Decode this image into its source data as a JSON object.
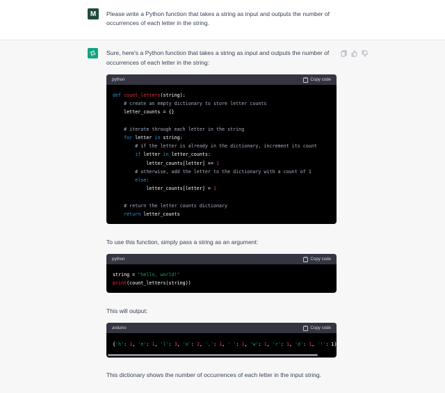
{
  "user": {
    "avatar_letter": "M",
    "message_line1": "Please write a Python function that takes a string as input and outputs the number of",
    "message_line2": "occurrences of each letter in the string."
  },
  "assistant": {
    "intro_line1": "Sure, here's a Python function that takes a string as input and outputs the number of",
    "intro_line2": "occurrences of each letter in the string:",
    "use_text": "To use this function, simply pass a string as an argument:",
    "output_text": "This will output:",
    "closing_text": "This dictionary shows the number of occurrences of each letter in the input string."
  },
  "code_blocks": [
    {
      "language": "python",
      "copy_label": "Copy code"
    },
    {
      "language": "python",
      "copy_label": "Copy code"
    },
    {
      "language": "arduino",
      "copy_label": "Copy code"
    }
  ],
  "code1": {
    "def": "def",
    "fname": "count_letters",
    "sig": "(string):",
    "c1": "# create an empty dictionary to store letter counts",
    "l1": "letter_counts = {}",
    "c2": "# iterate through each letter in the string",
    "for": "for",
    "for_mid": " letter ",
    "in": "in",
    "for_end": " string:",
    "c3": "# if the letter is already in the dictionary, increment its count",
    "if": "if",
    "if_mid": " letter ",
    "in2": "in",
    "if_end": " letter_counts:",
    "inc": "letter_counts[letter] += ",
    "one1": "1",
    "c4": "# otherwise, add the letter to the dictionary with a count of 1",
    "else": "else:",
    "assign": "letter_counts[letter] = ",
    "one2": "1",
    "c5": "# return the letter counts dictionary",
    "return": "return",
    "ret_val": " letter_counts"
  },
  "code2": {
    "var": "string = ",
    "str": "\"hello, world!\"",
    "print": "print",
    "args": "(count_letters(string))"
  },
  "code3": {
    "t1": "{",
    "k1": "'h'",
    "t2": ": ",
    "v1": "1",
    "t3": ", ",
    "k2": "'e'",
    "t4": ": ",
    "v2": "1",
    "t5": ", ",
    "k3": "'l'",
    "t6": ": ",
    "v3": "3",
    "t7": ", ",
    "k4": "'o'",
    "t8": ": ",
    "v4": "2",
    "t9": ", ",
    "k5": "','",
    "t10": ": ",
    "v5": "1",
    "t11": ", ",
    "k6": "' '",
    "t12": ": ",
    "v6": "1",
    "t13": ", ",
    "k7": "'w'",
    "t14": ": ",
    "v7": "1",
    "t15": ", ",
    "k8": "'r'",
    "t16": ": ",
    "v8": "1",
    "t17": ", ",
    "k9": "'d'",
    "t18": ": ",
    "v9": "1",
    "t19": ", ",
    "k10": "'!'",
    "t20": ": 1}"
  },
  "colors": {
    "brand": "#10a37f",
    "user_avatar": "#1f4b3f",
    "code_bg": "#000000",
    "code_header": "#343541"
  },
  "icons": [
    "copy-icon",
    "thumbs-up-icon",
    "thumbs-down-icon",
    "openai-logo-icon",
    "clipboard-icon"
  ]
}
